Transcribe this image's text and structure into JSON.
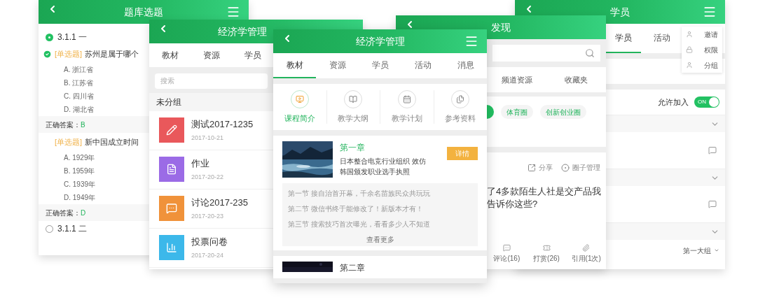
{
  "quiz_screen": {
    "title": "题库选题",
    "items": [
      {
        "kind": "section",
        "label": "3.1.1 一",
        "done": true
      },
      {
        "kind": "question",
        "checked": true,
        "tag": "[单选题]",
        "text": "苏州是属于哪个"
      },
      {
        "kind": "option",
        "text": "A. 浙江省"
      },
      {
        "kind": "option",
        "text": "B. 江苏省"
      },
      {
        "kind": "option",
        "text": "C. 四川省"
      },
      {
        "kind": "option",
        "text": "D. 湖北省"
      },
      {
        "kind": "answer",
        "label": "正确答案：",
        "value": "B"
      },
      {
        "kind": "question",
        "checked": false,
        "tag": "[单选题]",
        "text": "新中国成立时间"
      },
      {
        "kind": "option",
        "text": "A. 1929年"
      },
      {
        "kind": "option",
        "text": "B. 1959年"
      },
      {
        "kind": "option",
        "text": "C. 1939年"
      },
      {
        "kind": "option",
        "text": "D. 1949年"
      },
      {
        "kind": "answer",
        "label": "正确答案：",
        "value": "D"
      },
      {
        "kind": "section",
        "label": "3.1.1 二",
        "done": false
      }
    ]
  },
  "resource_screen": {
    "title": "经济学管理",
    "tabs": [
      {
        "label": "教材",
        "selected": false
      },
      {
        "label": "资源",
        "selected": false
      },
      {
        "label": "学员",
        "selected": false
      }
    ],
    "search": {
      "placeholder": "搜索"
    },
    "group": "未分组",
    "items": [
      {
        "kind": "test",
        "title": "测试2017-1235",
        "date": "2017-10-21",
        "color": "#e9585b"
      },
      {
        "kind": "homework",
        "title": "作业",
        "date": "2017-20-22",
        "color": "#9b6be6"
      },
      {
        "kind": "discussion",
        "title": "讨论2017-235",
        "date": "2017-20-23",
        "color": "#f0923a"
      },
      {
        "kind": "vote",
        "title": "投票问卷",
        "date": "2017-20-24",
        "color": "#3cb8ea"
      }
    ]
  },
  "course_screen": {
    "title": "经济学管理",
    "tabs": [
      {
        "label": "教材",
        "selected": true
      },
      {
        "label": "资源",
        "selected": false
      },
      {
        "label": "学员",
        "selected": false
      },
      {
        "label": "活动",
        "selected": false
      },
      {
        "label": "消息",
        "selected": false
      }
    ],
    "features": [
      {
        "kind": "intro",
        "label": "课程简介",
        "selected": true
      },
      {
        "kind": "outline",
        "label": "教学大纲",
        "selected": false
      },
      {
        "kind": "plan",
        "label": "教学计划",
        "selected": false
      },
      {
        "kind": "reference",
        "label": "参考资料",
        "selected": false
      }
    ],
    "chapters": [
      {
        "title": "第一章",
        "text": "日本整合电竞行业组织 效仿韩国颁发职业选手执照",
        "button": "详情",
        "sections": [
          "第一节 接自治首开幕，千余名苗族民众共玩玩",
          "第二节 微信书终于能修改了！新版本才有！",
          "第三节 搜索技巧首次曝光，看看多少人不知道"
        ],
        "more": "查看更多"
      },
      {
        "title": "第二章"
      }
    ]
  },
  "discover_screen": {
    "title": "发现",
    "channels": [
      "频道资源",
      "收藏夹"
    ],
    "tags": [
      "体育圈",
      "创新创业圈"
    ],
    "post": {
      "share": "分享",
      "manage": "圈子管理",
      "lines": [
        "了4多款陌生人社是交产品我",
        "告诉你这些?"
      ],
      "actions": [
        {
          "kind": "comment",
          "label": "评论(16)"
        },
        {
          "kind": "reward",
          "label": "打赏(26)"
        },
        {
          "kind": "cite",
          "label": "引用(1次)"
        }
      ]
    }
  },
  "members_screen": {
    "title": "学员",
    "tabs": [
      {
        "label": "学员",
        "selected": true
      },
      {
        "label": "活动",
        "selected": false
      }
    ],
    "menu": [
      {
        "kind": "invite",
        "label": "邀请"
      },
      {
        "kind": "permission",
        "label": "权限"
      },
      {
        "kind": "group",
        "label": "分组"
      }
    ],
    "join": {
      "label": "允许加入",
      "on": true,
      "state_text": "ON"
    },
    "rows": [
      {
        "kind": "group"
      },
      {
        "kind": "member"
      },
      {
        "kind": "group"
      },
      {
        "kind": "member"
      },
      {
        "kind": "group"
      }
    ],
    "group_select": "第一大组"
  }
}
